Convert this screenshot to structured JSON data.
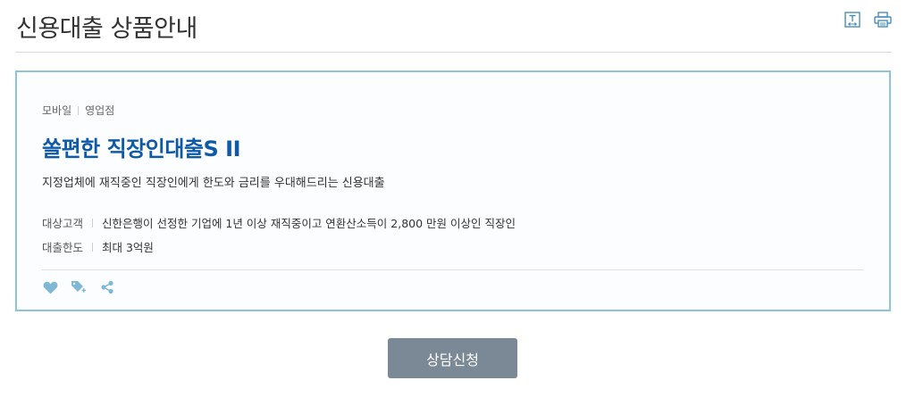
{
  "page": {
    "title": "신용대출 상품안내",
    "tools": [
      {
        "icon": "text-size-icon"
      },
      {
        "icon": "print-icon"
      }
    ]
  },
  "product": {
    "channels": [
      "모바일",
      "영업점"
    ],
    "name": "쏠편한 직장인대출S II",
    "description": "지정업체에 재직중인 직장인에게 한도와 금리를 우대해드리는 신용대출",
    "info": [
      {
        "label": "대상고객",
        "value": "신한은행이 선정한 기업에 1년 이상 재직중이고 연환산소득이 2,800 만원 이상인 직장인"
      },
      {
        "label": "대출한도",
        "value": "최대 3억원"
      }
    ],
    "actions": [
      {
        "icon": "heart-icon"
      },
      {
        "icon": "tag-add-icon"
      },
      {
        "icon": "share-icon"
      }
    ]
  },
  "cta": {
    "label": "상담신청"
  },
  "colors": {
    "accent": "#0f5aa8",
    "card_border": "#8ec3d8",
    "icon": "#7fb8d6",
    "button_bg": "#7b8896"
  }
}
